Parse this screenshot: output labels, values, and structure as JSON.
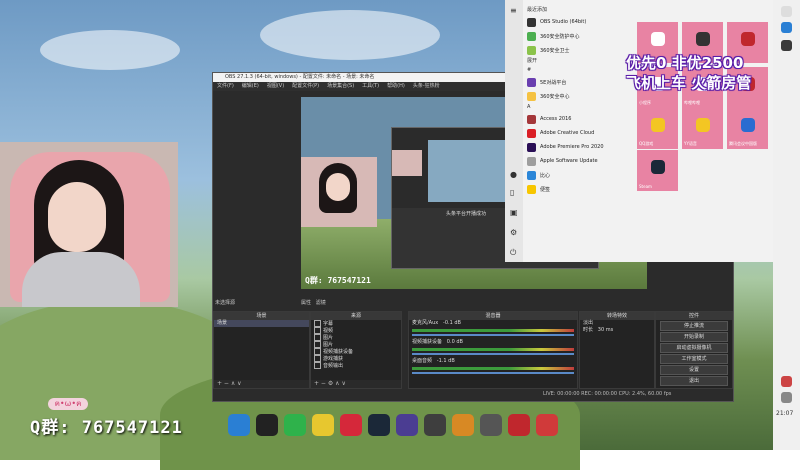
{
  "obs": {
    "title": "OBS 27.1.3 (64-bit, windows) - 配置文件: 未命名 - 场景: 未命名",
    "menu": [
      "文件(F)",
      "编辑(E)",
      "视图(V)",
      "配置文件(P)",
      "场景集合(S)",
      "工具(T)",
      "帮助(H)",
      "头条-狂热粉"
    ],
    "nested_text": "头条平台开播成功",
    "preview_label": "未选择源",
    "source_tabs": [
      "属性",
      "滤镜"
    ],
    "panels": {
      "scenes": {
        "title": "场景",
        "items": [
          "场景"
        ]
      },
      "sources": {
        "title": "来源",
        "items": [
          "字幕",
          "视频",
          "图片",
          "图片",
          "视频捕获设备",
          "游戏捕获",
          "音频输出"
        ]
      },
      "mixer": {
        "title": "混音器",
        "channels": [
          {
            "name": "麦克风/Aux",
            "db": "-0.1 dB"
          },
          {
            "name": "视频捕获设备",
            "db": "0.0 dB"
          },
          {
            "name": "桌面音频",
            "db": "-1.1 dB"
          }
        ]
      },
      "transitions": {
        "title": "转场特效",
        "type": "淡出",
        "duration_label": "时长",
        "duration": "30 ms"
      },
      "controls": {
        "title": "控件",
        "buttons": [
          "停止推流",
          "开始录制",
          "启动虚拟摄像机",
          "工作室模式",
          "设置",
          "退出"
        ]
      }
    },
    "status": "LIVE: 00:00:00   REC: 00:00:00   CPU: 2.4%, 60.00 fps"
  },
  "stream": {
    "qq_group": "Q群: 767547121",
    "overlay_line1": "优先0 非优2500",
    "overlay_line2": "飞机上车 火箭房管",
    "tag": "ฅ•ω•ฅ"
  },
  "start_menu": {
    "sections": [
      "最近添加",
      "展开",
      "#",
      "A"
    ],
    "recent": [
      "OBS Studio (64bit)",
      "360安全防护中心",
      "360安全卫士"
    ],
    "hash_apps": [
      "5E对战平台",
      "360安全中心"
    ],
    "a_apps": [
      "Access 2016",
      "Adobe Creative Cloud",
      "Adobe Premiere Pro 2020",
      "Apple Software Update"
    ],
    "b_apps": [
      "比心",
      "便签"
    ],
    "tiles": [
      {
        "label": "",
        "color": "#e883a3"
      },
      {
        "label": "OBS Studio",
        "color": "#e883a3"
      },
      {
        "label": "",
        "color": "#e883a3"
      },
      {
        "label": "小程序",
        "color": "#e883a3"
      },
      {
        "label": "哔哩哔哩",
        "color": "#e883a3"
      },
      {
        "label": "",
        "color": "#e883a3"
      },
      {
        "label": "QQ游戏",
        "color": "#e883a3"
      },
      {
        "label": "YY语音",
        "color": "#e883a3"
      },
      {
        "label": "腾讯会议中国版",
        "color": "#e883a3"
      },
      {
        "label": "Steam",
        "color": "#e883a3"
      }
    ]
  },
  "clock": "21:07"
}
